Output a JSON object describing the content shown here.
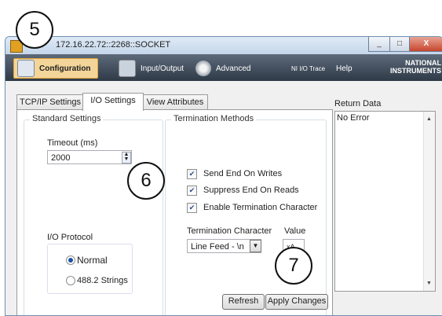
{
  "window": {
    "title": "172.16.22.72::2268::SOCKET",
    "min_label": "_",
    "max_label": "□",
    "close_label": "X"
  },
  "toolbar": {
    "configuration": "Configuration",
    "input_output": "Input/Output",
    "advanced": "Advanced",
    "ni_io_trace": "NI I/O Trace",
    "help": "Help",
    "logo_line1": "NATIONAL",
    "logo_line2": "INSTRUMENTS"
  },
  "tabs": [
    "TCP/IP Settings",
    "I/O Settings",
    "View Attributes"
  ],
  "standard_settings": {
    "title": "Standard Settings",
    "timeout_label": "Timeout (ms)",
    "timeout_value": "2000",
    "io_protocol_label": "I/O Protocol",
    "protocol_options": [
      "Normal",
      "488.2 Strings"
    ]
  },
  "termination": {
    "title": "Termination Methods",
    "checks": [
      "Send End On Writes",
      "Suppress End On Reads",
      "Enable Termination Character"
    ],
    "char_label": "Termination Character",
    "char_value": "Line Feed - \\n",
    "value_label": "Value",
    "value_value": "xA"
  },
  "return_data": {
    "label": "Return Data",
    "value": "No Error"
  },
  "buttons": {
    "refresh": "Refresh",
    "apply": "Apply Changes"
  },
  "callouts": [
    "5",
    "6",
    "7"
  ]
}
